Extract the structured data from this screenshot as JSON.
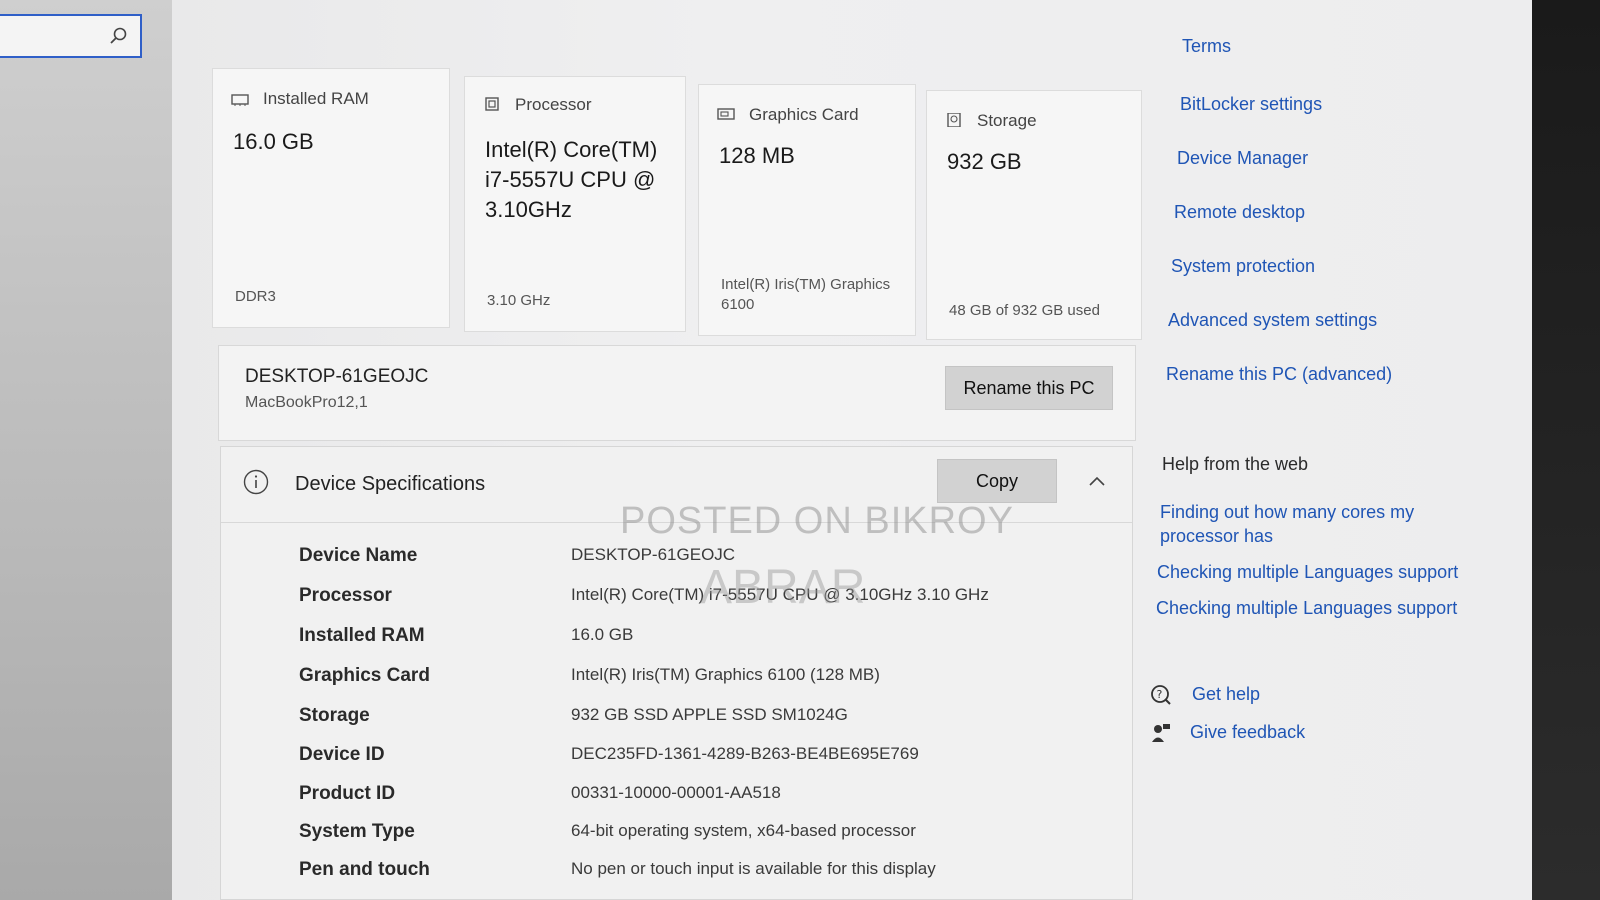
{
  "cards": [
    {
      "title": "Installed RAM",
      "value": "16.0 GB",
      "sub": "DDR3",
      "icon": "ram-icon"
    },
    {
      "title": "Processor",
      "value": "Intel(R) Core(TM) i7-5557U CPU @ 3.10GHz",
      "sub": "3.10 GHz",
      "icon": "processor-icon"
    },
    {
      "title": "Graphics Card",
      "value": "128 MB",
      "sub": "Intel(R) Iris(TM) Graphics 6100",
      "icon": "graphics-card-icon"
    },
    {
      "title": "Storage",
      "value": "932 GB",
      "sub": "48 GB of 932 GB used",
      "icon": "storage-icon"
    }
  ],
  "device": {
    "name": "DESKTOP-61GEOJC",
    "model": "MacBookPro12,1",
    "rename_label": "Rename this PC"
  },
  "specs": {
    "title": "Device Specifications",
    "copy_label": "Copy",
    "rows": [
      {
        "label": "Device Name",
        "value": "DESKTOP-61GEOJC"
      },
      {
        "label": "Processor",
        "value": "Intel(R) Core(TM) i7-5557U CPU @ 3.10GHz   3.10 GHz"
      },
      {
        "label": "Installed RAM",
        "value": "16.0 GB"
      },
      {
        "label": "Graphics Card",
        "value": "Intel(R) Iris(TM) Graphics 6100 (128 MB)"
      },
      {
        "label": "Storage",
        "value": "932 GB SSD APPLE SSD SM1024G"
      },
      {
        "label": "Device ID",
        "value": "DEC235FD-1361-4289-B263-BE4BE695E769"
      },
      {
        "label": "Product ID",
        "value": "00331-10000-00001-AA518"
      },
      {
        "label": "System Type",
        "value": "64-bit operating system, x64-based processor"
      },
      {
        "label": "Pen and touch",
        "value": "No pen or touch input is available for this display"
      }
    ]
  },
  "related_links": [
    "Terms",
    "BitLocker settings",
    "Device Manager",
    "Remote desktop",
    "System protection",
    "Advanced system settings",
    "Rename this PC (advanced)"
  ],
  "help": {
    "title": "Help from the web",
    "links": [
      "Finding out how many cores my processor has",
      "Checking multiple Languages support",
      "Checking multiple Languages support"
    ],
    "get_help": "Get help",
    "give_feedback": "Give feedback"
  },
  "watermark": {
    "line1": "POSTED ON BIKROY",
    "line2": "ABRAR"
  },
  "colors": {
    "link": "#1f55b5",
    "search_border": "#2f5fc8"
  }
}
